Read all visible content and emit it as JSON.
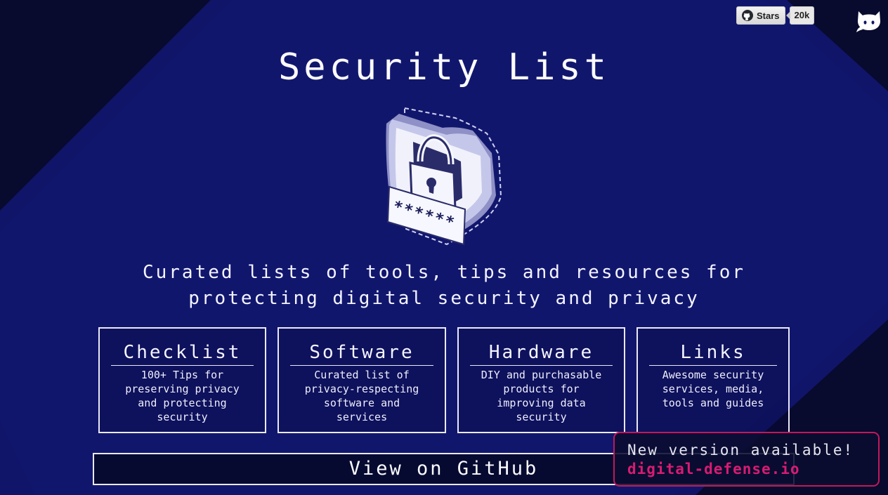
{
  "github_button": {
    "label": "Stars",
    "count": "20k",
    "icon": "github-icon"
  },
  "corner_icon": "octocat-icon",
  "page": {
    "title": "Security List",
    "tagline_line1": "Curated lists of tools, tips and resources for",
    "tagline_line2": "protecting digital security and privacy",
    "hero_icon": "shield-lock-icon",
    "password_mask": "******"
  },
  "cards": [
    {
      "title": "Checklist",
      "desc": [
        "100+ Tips for",
        "preserving privacy",
        "and protecting",
        "security"
      ]
    },
    {
      "title": "Software",
      "desc": [
        "Curated list of",
        "privacy-respecting",
        "software and",
        "services"
      ]
    },
    {
      "title": "Hardware",
      "desc": [
        "DIY and purchasable",
        "products for",
        "improving data",
        "security"
      ]
    },
    {
      "title": "Links",
      "desc": [
        "Awesome security",
        "services, media,",
        "tools and guides"
      ]
    }
  ],
  "github_link": {
    "label": "View on GitHub"
  },
  "banner": {
    "message": "New version available!",
    "domain": "digital-defense.io"
  },
  "colors": {
    "background": "#0a0d3a",
    "band": "#101664",
    "accent": "#c2185b",
    "card_border": "#e9e9f5"
  }
}
